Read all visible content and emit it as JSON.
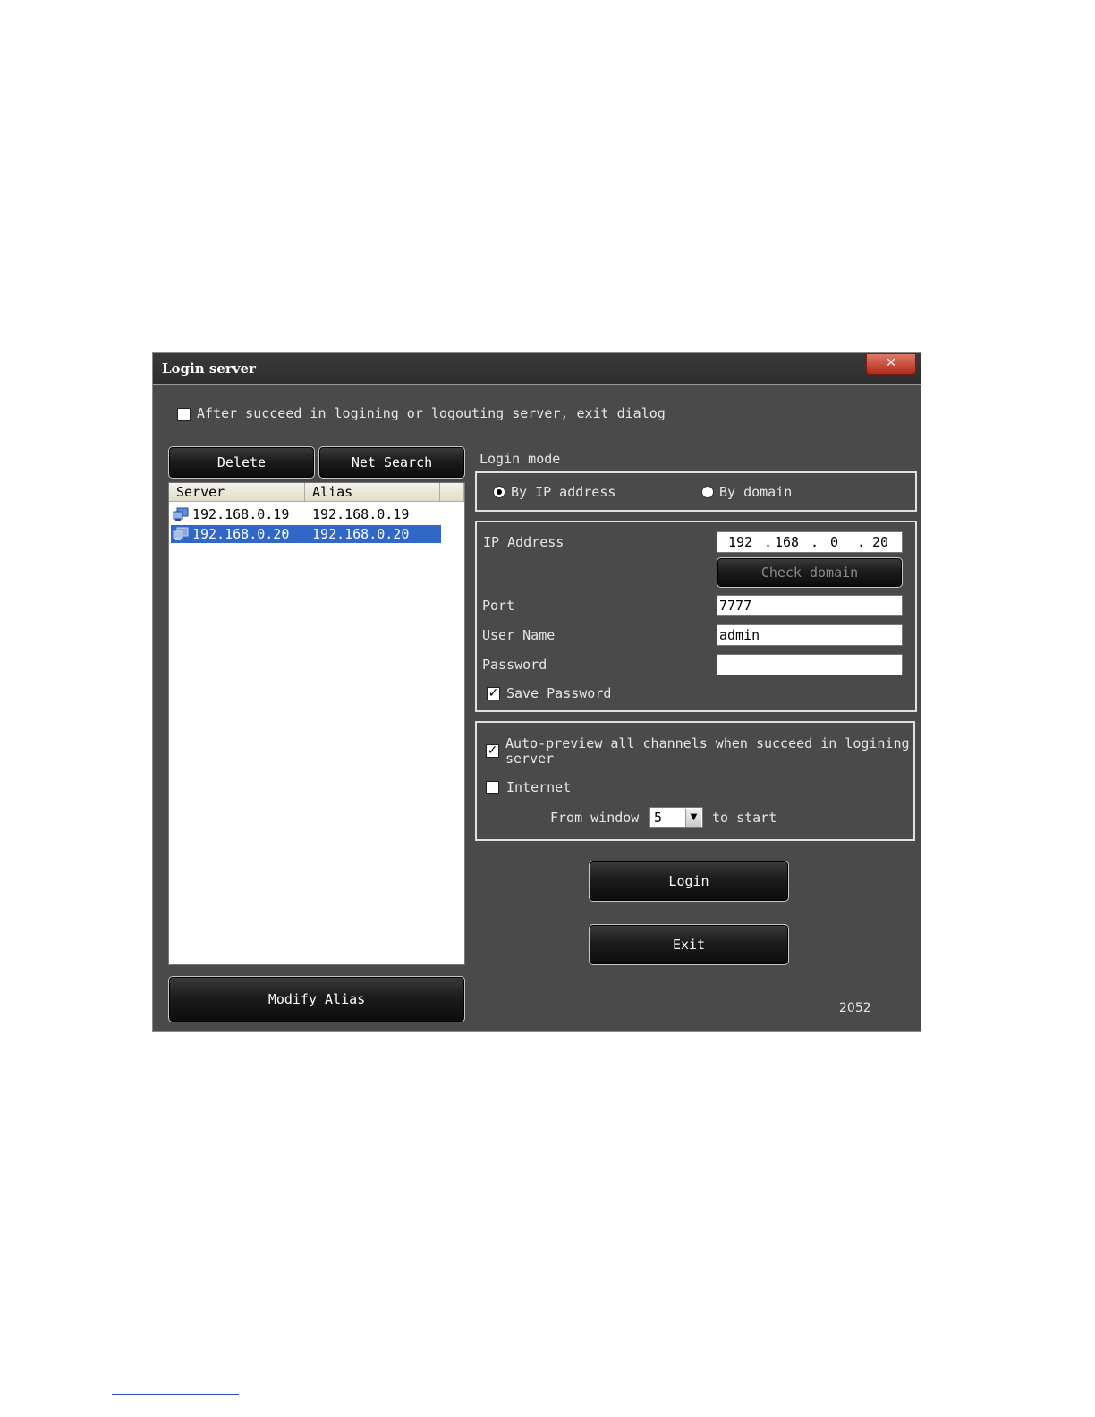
{
  "window": {
    "title": "Login server",
    "close_label": "✕"
  },
  "exit_after_login": {
    "checked": false,
    "label": "After succeed in logining or logouting server, exit dialog"
  },
  "server_panel": {
    "delete_label": "Delete",
    "net_search_label": "Net Search",
    "columns": [
      "Server",
      "Alias"
    ],
    "rows": [
      {
        "server": "192.168.0.19",
        "alias": "192.168.0.19",
        "selected": false
      },
      {
        "server": "192.168.0.20",
        "alias": "192.168.0.20",
        "selected": true
      }
    ],
    "modify_alias_label": "Modify Alias"
  },
  "login_mode": {
    "heading": "Login mode",
    "by_ip_label": "By IP address",
    "by_domain_label": "By domain",
    "selected": "ip"
  },
  "connection": {
    "ip_label": "IP Address",
    "ip_octets": [
      "192",
      "168",
      "0",
      "20"
    ],
    "ip_dot": ".",
    "check_domain_label": "Check domain",
    "port_label": "Port",
    "port_value": "7777",
    "username_label": "User Name",
    "username_value": "admin",
    "password_label": "Password",
    "password_value": "",
    "save_password_label": "Save Password",
    "save_password_checked": true
  },
  "preview": {
    "auto_preview_label_line1": "Auto-preview all channels when succeed in logining",
    "auto_preview_label_line2": "server",
    "auto_preview_checked": true,
    "internet_label": "Internet",
    "internet_checked": false,
    "from_window_label": "From window",
    "window_value": "5",
    "to_start_label": "to start"
  },
  "actions": {
    "login_label": "Login",
    "exit_label": "Exit"
  },
  "version": "2052"
}
